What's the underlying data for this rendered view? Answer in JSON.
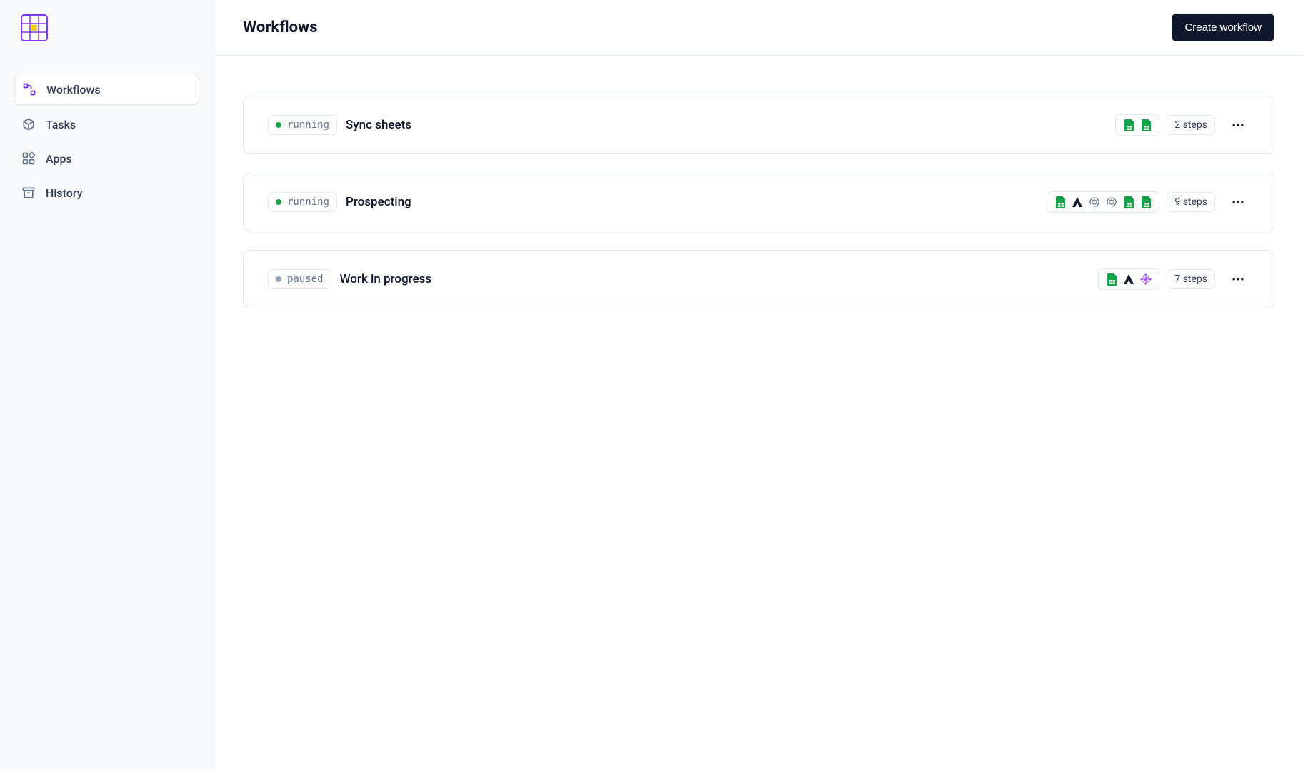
{
  "sidebar": {
    "items": [
      {
        "label": "Workflows",
        "icon": "workflow-icon",
        "active": true
      },
      {
        "label": "Tasks",
        "icon": "cube-icon",
        "active": false
      },
      {
        "label": "Apps",
        "icon": "apps-icon",
        "active": false
      },
      {
        "label": "History",
        "icon": "archive-icon",
        "active": false
      }
    ]
  },
  "header": {
    "title": "Workflows",
    "create_label": "Create workflow"
  },
  "workflows": [
    {
      "status": "running",
      "name": "Sync sheets",
      "steps_label": "2 steps",
      "apps": [
        "sheets",
        "sheets"
      ]
    },
    {
      "status": "running",
      "name": "Prospecting",
      "steps_label": "9 steps",
      "apps": [
        "sheets",
        "agent",
        "openai",
        "openai",
        "sheets",
        "sheets"
      ]
    },
    {
      "status": "paused",
      "name": "Work in progress",
      "steps_label": "7 steps",
      "apps": [
        "sheets",
        "agent",
        "stackly"
      ]
    }
  ]
}
